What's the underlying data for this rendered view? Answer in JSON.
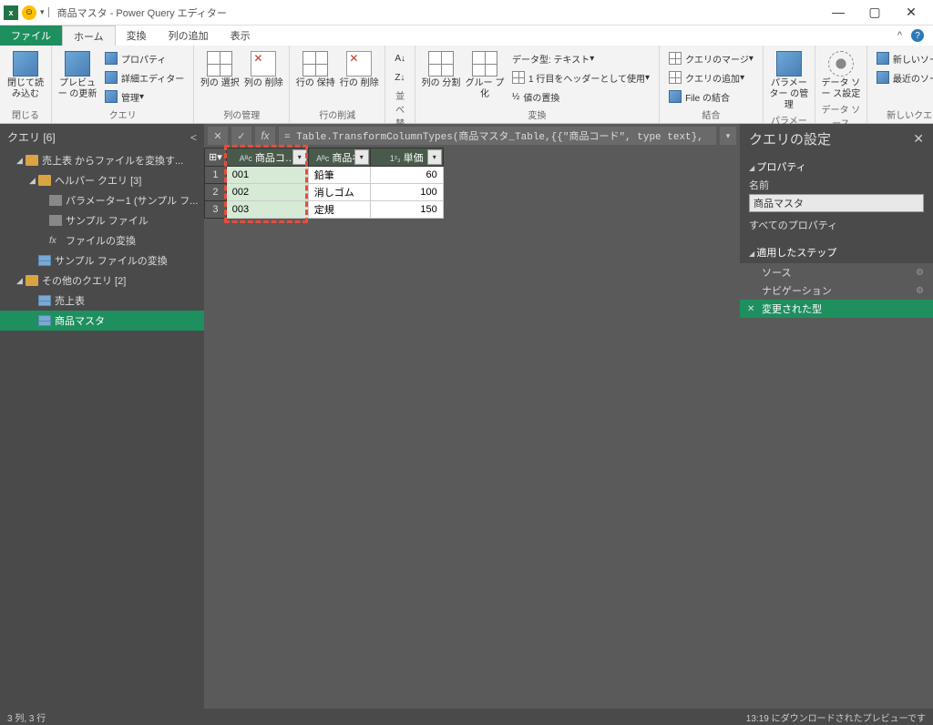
{
  "title_bar": {
    "title": "商品マスタ - Power Query エディター"
  },
  "ribbon_tabs": {
    "file": "ファイル",
    "home": "ホーム",
    "transform": "変換",
    "add_col": "列の追加",
    "view": "表示"
  },
  "ribbon": {
    "close": {
      "btn": "閉じて読\nみ込む",
      "group": "閉じる"
    },
    "query": {
      "preview": "プレビュー\nの更新",
      "props": "プロパティ",
      "adv": "詳細エディター",
      "manage": "管理",
      "group": "クエリ"
    },
    "cols_manage": {
      "choose": "列の\n選択",
      "remove": "列の\n削除",
      "group": "列の管理"
    },
    "rows": {
      "keep": "行の\n保持",
      "remove": "行の\n削除",
      "group": "行の削減"
    },
    "sort": {
      "group": "並べ替え"
    },
    "split": "列の\n分割",
    "groupby": "グルー\nプ化",
    "transform": {
      "dtype": "データ型: テキスト",
      "header": "1 行目をヘッダーとして使用",
      "replace": "値の置換",
      "group": "変換"
    },
    "combine": {
      "merge": "クエリのマージ",
      "append": "クエリの追加",
      "files": "File の結合",
      "group": "結合"
    },
    "params": {
      "btn": "パラメーター\nの管理",
      "group": "パラメーター"
    },
    "ds": {
      "btn": "データ ソー\nス設定",
      "group": "データ ソース"
    },
    "newq": {
      "new": "新しいソース",
      "recent": "最近のソース",
      "group": "新しいクエリ"
    }
  },
  "queries": {
    "header": "クエリ [6]",
    "items": [
      {
        "label": "売上表 からファイルを変換す...",
        "kind": "folder",
        "lvl": 0
      },
      {
        "label": "ヘルパー クエリ [3]",
        "kind": "folder",
        "lvl": 1
      },
      {
        "label": "パラメーター1 (サンプル フ...",
        "kind": "param",
        "lvl": 2
      },
      {
        "label": "サンプル ファイル",
        "kind": "file",
        "lvl": 2
      },
      {
        "label": "ファイルの変換",
        "kind": "fx",
        "lvl": 2
      },
      {
        "label": "サンプル ファイルの変換",
        "kind": "table",
        "lvl": 1
      },
      {
        "label": "その他のクエリ [2]",
        "kind": "folder",
        "lvl": 0
      },
      {
        "label": "売上表",
        "kind": "table",
        "lvl": 1
      },
      {
        "label": "商品マスタ",
        "kind": "table",
        "lvl": 1,
        "selected": true
      }
    ]
  },
  "formula": "= Table.TransformColumnTypes(商品マスタ_Table,{{\"商品コード\", type text},",
  "grid": {
    "headers": [
      {
        "type": "ABC",
        "label": "商品コ…"
      },
      {
        "type": "ABC",
        "label": "商品名"
      },
      {
        "type": "123",
        "label": "単価"
      }
    ],
    "rows": [
      {
        "n": "1",
        "c0": "001",
        "c1": "鉛筆",
        "c2": "60"
      },
      {
        "n": "2",
        "c0": "002",
        "c1": "消しゴム",
        "c2": "100"
      },
      {
        "n": "3",
        "c0": "003",
        "c1": "定規",
        "c2": "150"
      }
    ]
  },
  "settings": {
    "title": "クエリの設定",
    "props_section": "プロパティ",
    "name_label": "名前",
    "name_value": "商品マスタ",
    "all_props": "すべてのプロパティ",
    "steps_section": "適用したステップ",
    "steps": [
      {
        "label": "ソース",
        "gear": true
      },
      {
        "label": "ナビゲーション",
        "gear": true
      },
      {
        "label": "変更された型",
        "active": true,
        "x": true
      }
    ]
  },
  "statusbar": {
    "left": "3 列, 3 行",
    "right": "13:19 にダウンロードされたプレビューです"
  }
}
